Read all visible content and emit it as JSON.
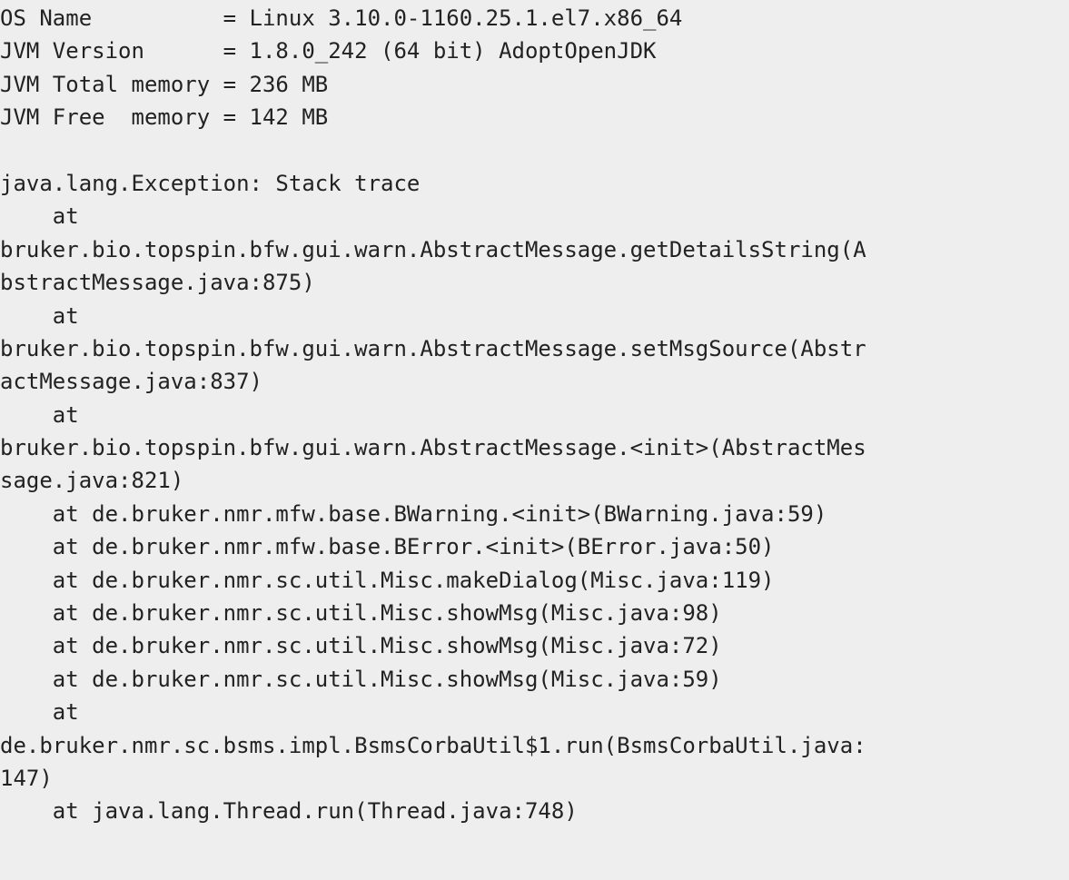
{
  "log": {
    "lines": [
      "OS Name          = Linux 3.10.0-1160.25.1.el7.x86_64",
      "JVM Version      = 1.8.0_242 (64 bit) AdoptOpenJDK",
      "JVM Total memory = 236 MB",
      "JVM Free  memory = 142 MB",
      "",
      "java.lang.Exception: Stack trace",
      "    at",
      "bruker.bio.topspin.bfw.gui.warn.AbstractMessage.getDetailsString(A",
      "bstractMessage.java:875)",
      "    at",
      "bruker.bio.topspin.bfw.gui.warn.AbstractMessage.setMsgSource(Abstr",
      "actMessage.java:837)",
      "    at",
      "bruker.bio.topspin.bfw.gui.warn.AbstractMessage.<init>(AbstractMes",
      "sage.java:821)",
      "    at de.bruker.nmr.mfw.base.BWarning.<init>(BWarning.java:59)",
      "    at de.bruker.nmr.mfw.base.BError.<init>(BError.java:50)",
      "    at de.bruker.nmr.sc.util.Misc.makeDialog(Misc.java:119)",
      "    at de.bruker.nmr.sc.util.Misc.showMsg(Misc.java:98)",
      "    at de.bruker.nmr.sc.util.Misc.showMsg(Misc.java:72)",
      "    at de.bruker.nmr.sc.util.Misc.showMsg(Misc.java:59)",
      "    at",
      "de.bruker.nmr.sc.bsms.impl.BsmsCorbaUtil$1.run(BsmsCorbaUtil.java:",
      "147)",
      "    at java.lang.Thread.run(Thread.java:748)"
    ]
  }
}
